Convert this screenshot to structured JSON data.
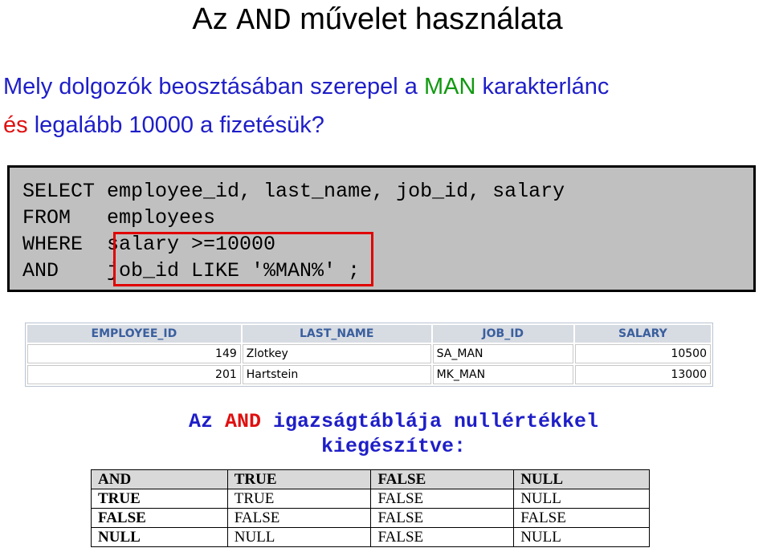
{
  "title": {
    "pre": "Az ",
    "mono": "AND",
    "post": " művelet használata"
  },
  "question": {
    "p1": "Mely dolgozók beosztásában szerepel a ",
    "green": "MAN",
    "p2": " karakterlánc",
    "red": "és",
    "p3": " legalább 10000 a fizetésük?"
  },
  "sql": {
    "lines": [
      "SELECT employee_id, last_name, job_id, salary",
      "FROM   employees",
      "WHERE  salary >=10000",
      "AND    job_id LIKE '%MAN%' ;"
    ]
  },
  "result": {
    "headers": [
      "EMPLOYEE_ID",
      "LAST_NAME",
      "JOB_ID",
      "SALARY"
    ],
    "rows": [
      [
        "149",
        "Zlotkey",
        "SA_MAN",
        "10500"
      ],
      [
        "201",
        "Hartstein",
        "MK_MAN",
        "13000"
      ]
    ]
  },
  "truth_title": {
    "pre": "Az ",
    "red": "AND",
    "post": " igazságtáblája nullértékkel kiegészítve:"
  },
  "truth_table": {
    "rows": [
      [
        "AND",
        "TRUE",
        "FALSE",
        "NULL"
      ],
      [
        "TRUE",
        "TRUE",
        "FALSE",
        "NULL"
      ],
      [
        "FALSE",
        "FALSE",
        "FALSE",
        "FALSE"
      ],
      [
        "NULL",
        "NULL",
        "FALSE",
        "NULL"
      ]
    ]
  },
  "colors": {
    "blue_text": "#1e1ec8",
    "green_text": "#119911",
    "red_text": "#e01010",
    "sql_box_bg": "#c0c0c0",
    "result_header_bg": "#d7dbe2",
    "result_header_text": "#3a5f9e",
    "highlight_border": "#e00000"
  }
}
